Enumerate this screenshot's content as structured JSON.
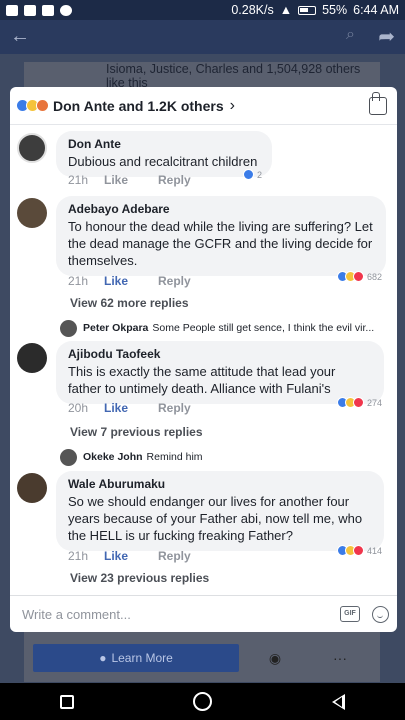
{
  "status_bar": {
    "speed": "0.28K/s",
    "battery": "55%",
    "time": "6:44 AM"
  },
  "background": {
    "likes_text": "Isioma, Justice, Charles and 1,504,928 others like this",
    "learn_more_label": "Learn More",
    "messenger_icon": "messenger-icon",
    "more_icon": "more-dots-icon"
  },
  "header": {
    "title": "Don Ante and 1.2K others",
    "chevron": "›",
    "reactions": [
      "like",
      "haha",
      "love"
    ]
  },
  "comments": [
    {
      "author": "Don Ante",
      "text": "Dubious and recalcitrant children",
      "time": "21h",
      "like_label": "Like",
      "liked": false,
      "reply_label": "Reply",
      "reaction_count": "2",
      "reactions": [
        "like"
      ]
    },
    {
      "author": "Adebayo Adebare",
      "text": "To honour the dead while the living are suffering? Let the dead manage the GCFR and the living decide for themselves.",
      "time": "21h",
      "like_label": "Like",
      "liked": true,
      "reply_label": "Reply",
      "reaction_count": "682",
      "reactions": [
        "like",
        "haha",
        "love"
      ],
      "more_replies": "View 62 more replies",
      "reply_preview": {
        "name": "Peter Okpara",
        "text": "Some People still get sence, I think the evil vir..."
      }
    },
    {
      "author": "Ajibodu Taofeek",
      "text": "This is exactly the same attitude that lead your father to untimely death. Alliance with Fulani's",
      "time": "20h",
      "like_label": "Like",
      "liked": true,
      "reply_label": "Reply",
      "reaction_count": "274",
      "reactions": [
        "like",
        "haha",
        "love"
      ],
      "more_replies": "View 7 previous replies",
      "reply_preview": {
        "name": "Okeke John",
        "text": "Remind him"
      }
    },
    {
      "author": "Wale Aburumaku",
      "text": "So we should endanger our lives for another four years because of your Father abi, now tell me, who the HELL is ur fucking freaking Father?",
      "time": "21h",
      "like_label": "Like",
      "liked": true,
      "reply_label": "Reply",
      "reaction_count": "414",
      "reactions": [
        "like",
        "haha",
        "love"
      ],
      "more_replies": "View 23 previous replies"
    }
  ],
  "composer": {
    "placeholder": "Write a comment...",
    "gif_label": "GIF"
  },
  "colors": {
    "facebook_blue": "#4267b2",
    "like_blue": "#3b7ce8",
    "haha_yellow": "#f5c33b",
    "love_red": "#f0364c"
  }
}
